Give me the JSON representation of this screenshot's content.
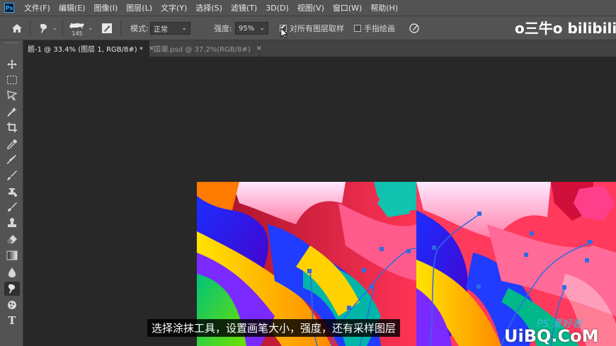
{
  "app": {
    "logo": "Ps"
  },
  "menu": [
    "文件(F)",
    "编辑(E)",
    "图像(I)",
    "图层(L)",
    "文字(Y)",
    "选择(S)",
    "滤镜(T)",
    "3D(D)",
    "视图(V)",
    "窗口(W)",
    "帮助(H)"
  ],
  "options": {
    "brush_size": "145",
    "mode_label": "模式:",
    "mode_value": "正常",
    "strength_label": "强度:",
    "strength_value": "95%",
    "sample_all_layers_label": "对所有图层取样",
    "sample_all_layers_checked": true,
    "finger_paint_label": "手指绘画",
    "finger_paint_checked": false
  },
  "tabs": [
    {
      "label": "题-1 @ 33.4% (图层 1, RGB/8#) *",
      "active": true
    },
    {
      "label": "国潮.psd @ 37.2%(RGB/8#)",
      "active": false
    }
  ],
  "tabs_close": "×",
  "watermark": {
    "text": "o三牛o bilibili"
  },
  "subtitle": {
    "text": "选择涂抹工具，设置画笔大小，强度，还有采样图层"
  },
  "site_watermark": {
    "ps_text": "PS 爱好者",
    "domain_text": "UiBQ.CoM"
  },
  "tools": [
    "move-icon",
    "marquee-icon",
    "lasso-icon",
    "magic-wand-icon",
    "crop-icon",
    "eyedropper-icon",
    "healing-brush-icon",
    "brush-icon",
    "clone-stamp-icon",
    "history-brush-icon",
    "eraser-icon",
    "gradient-icon",
    "blur-icon",
    "smudge-icon",
    "dodge-icon",
    "type-icon"
  ],
  "colors": {
    "accent": "#31a8ff",
    "panel": "#535353",
    "workspace": "#282828"
  }
}
